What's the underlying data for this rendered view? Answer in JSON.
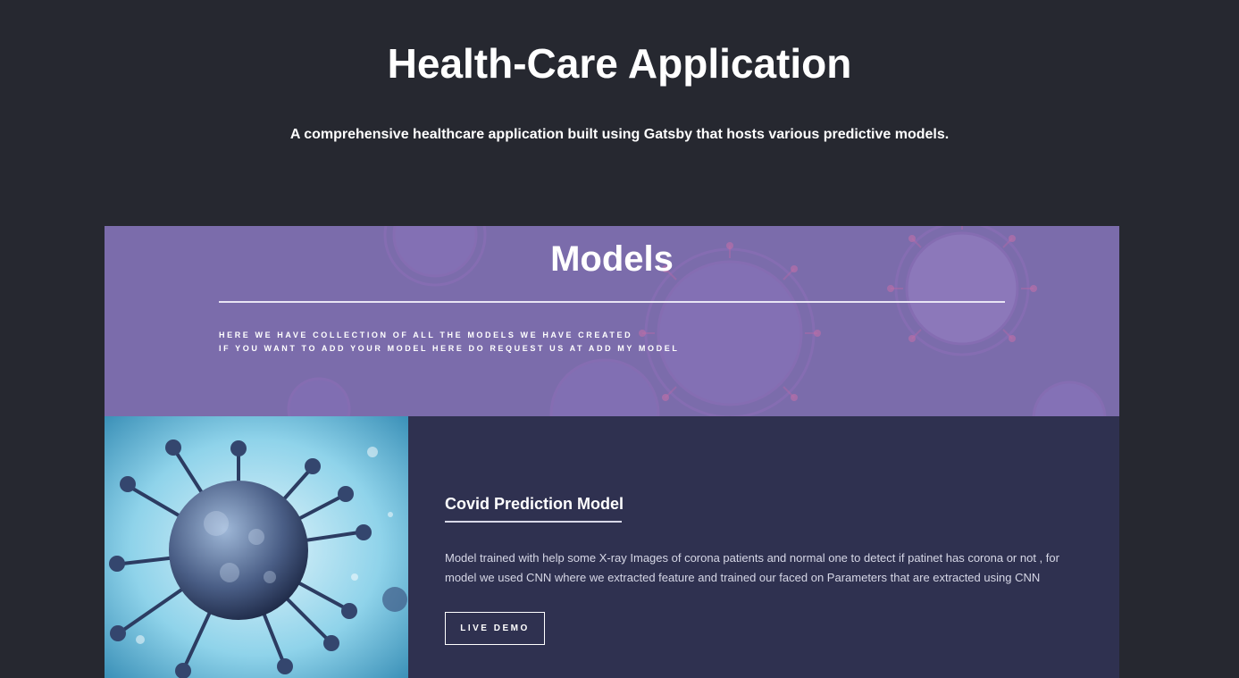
{
  "hero": {
    "title": "Health-Care Application",
    "subtitle": "A comprehensive healthcare application built using Gatsby that hosts various predictive models."
  },
  "models_section": {
    "title": "Models",
    "description_lines": [
      "HERE WE HAVE COLLECTION OF ALL THE MODELS WE HAVE CREATED",
      "IF YOU WANT TO ADD YOUR MODEL HERE DO REQUEST US AT ADD MY MODEL"
    ],
    "banner_image": "virus-illustration-icon"
  },
  "model_cards": [
    {
      "title": "Covid Prediction Model",
      "description": "Model trained with help some X-ray Images of corona patients and normal one to detect if patinet has corona or not , for model we used CNN where we extracted feature and trained our faced on Parameters that are extracted using CNN",
      "button_label": "LIVE DEMO",
      "image": "coronavirus-icon"
    }
  ],
  "colors": {
    "page_background": "#262830",
    "banner_background": "#7b6cab",
    "card_background": "#2f3150",
    "text_primary": "#ffffff",
    "text_secondary": "#d6d7e6"
  }
}
